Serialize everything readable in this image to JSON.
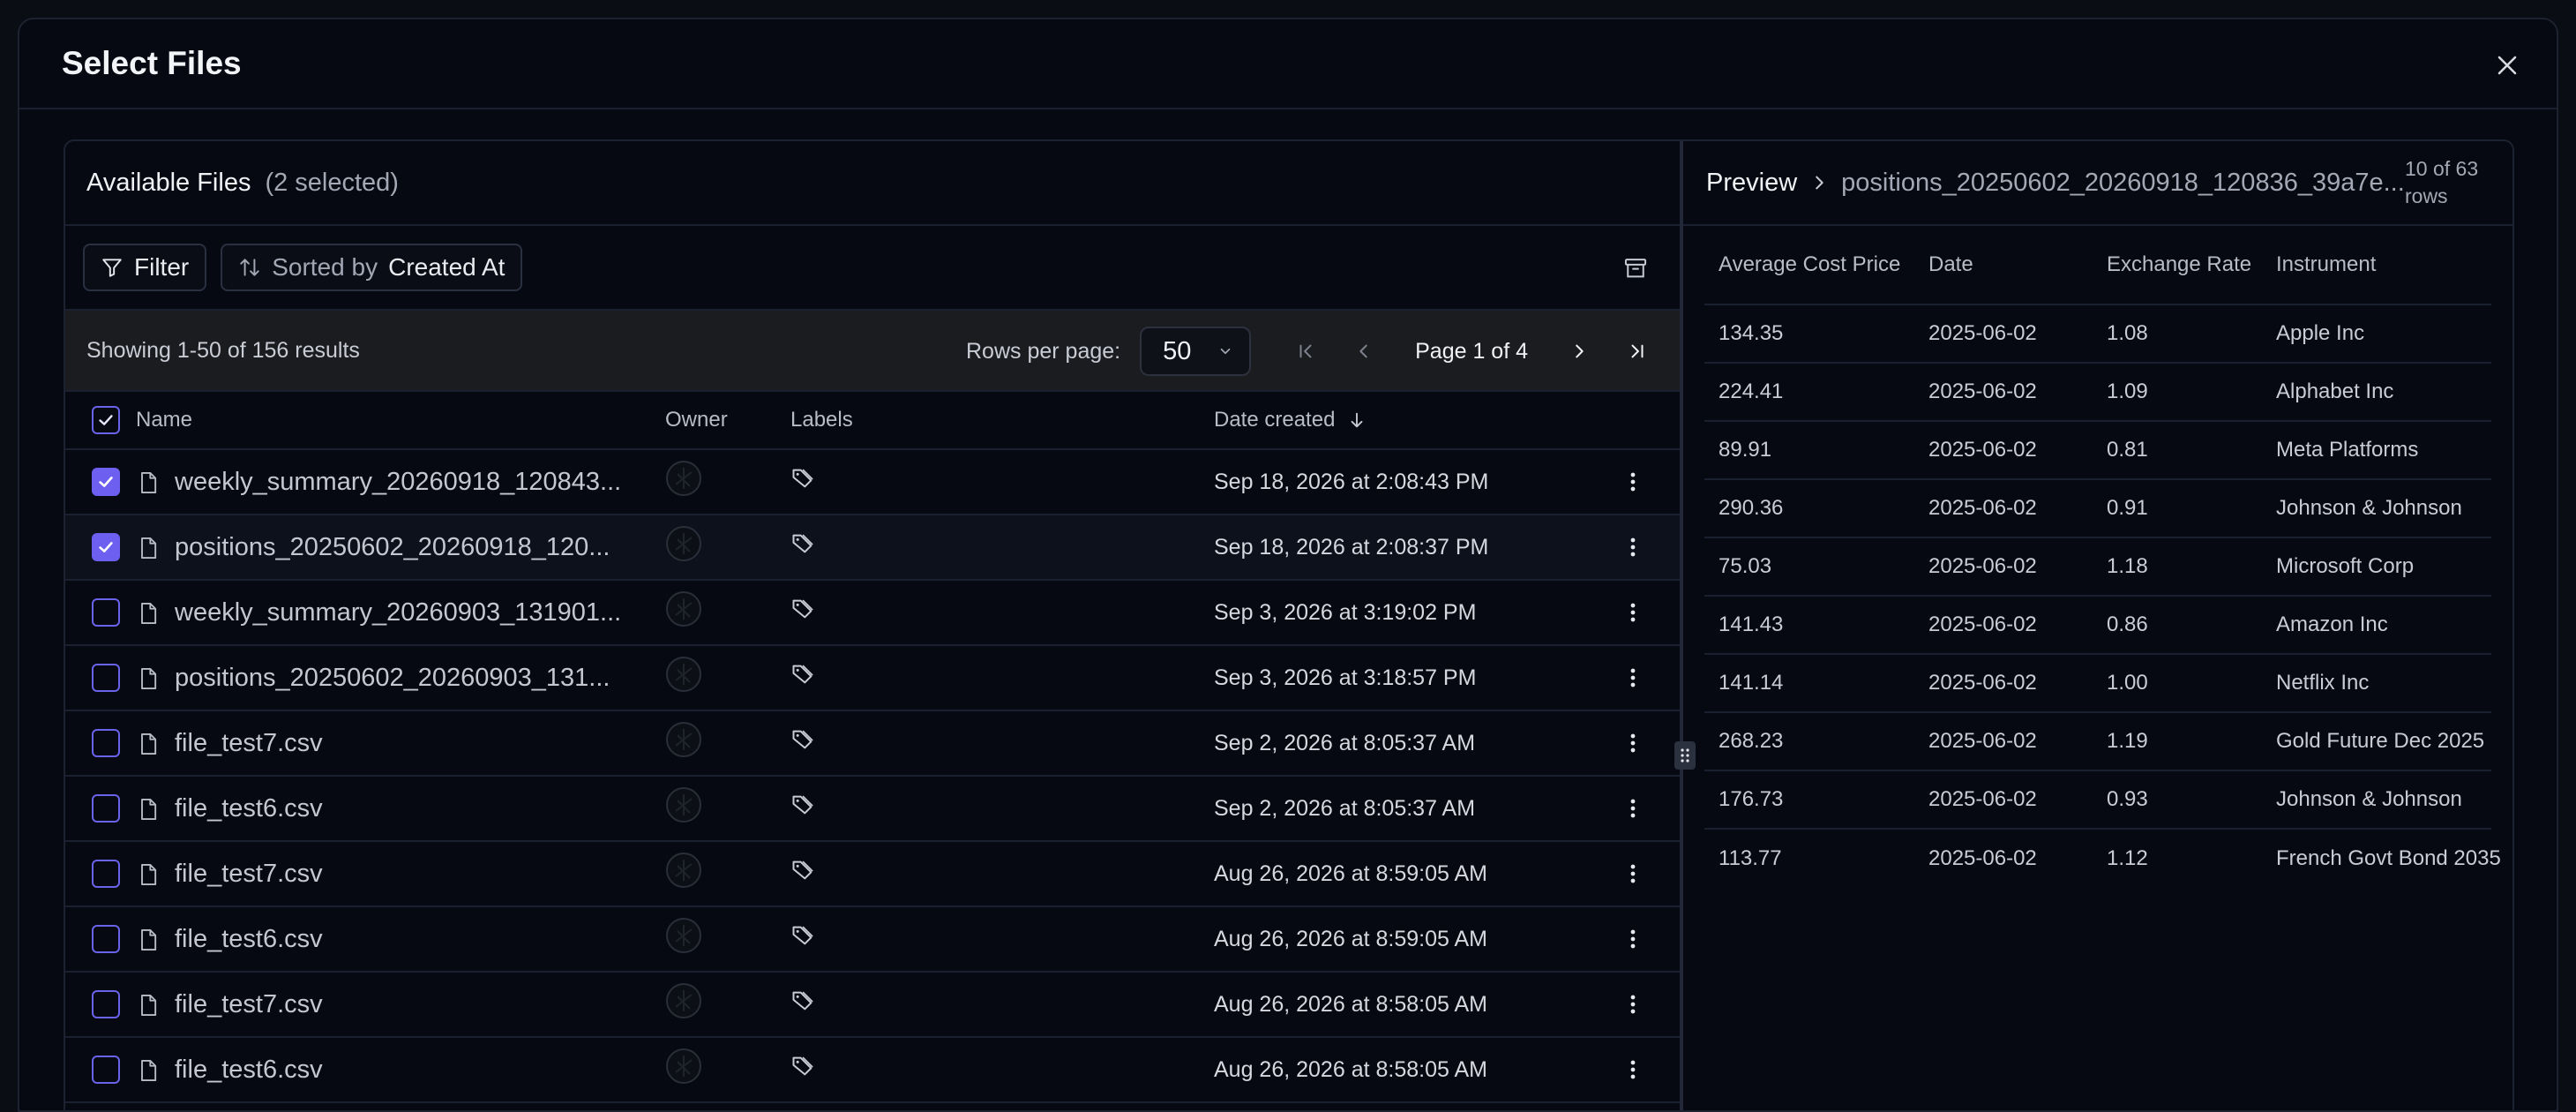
{
  "dialog": {
    "title": "Select Files"
  },
  "files_panel": {
    "title": "Available Files",
    "selected_count": "(2 selected)",
    "filter_label": "Filter",
    "sorted_by_prefix": "Sorted by",
    "sorted_by_value": "Created At",
    "showing": "Showing 1-50 of 156 results",
    "rows_per_page_label": "Rows per page:",
    "rows_per_page_value": "50",
    "page_label": "Page 1 of 4",
    "columns": {
      "name": "Name",
      "owner": "Owner",
      "labels": "Labels",
      "date": "Date created"
    },
    "rows": [
      {
        "name": "weekly_summary_20260918_120843...",
        "date": "Sep 18, 2026 at 2:08:43 PM",
        "checked": true
      },
      {
        "name": "positions_20250602_20260918_120...",
        "date": "Sep 18, 2026 at 2:08:37 PM",
        "checked": true
      },
      {
        "name": "weekly_summary_20260903_131901...",
        "date": "Sep 3, 2026 at 3:19:02 PM",
        "checked": false
      },
      {
        "name": "positions_20250602_20260903_131...",
        "date": "Sep 3, 2026 at 3:18:57 PM",
        "checked": false
      },
      {
        "name": "file_test7.csv",
        "date": "Sep 2, 2026 at 8:05:37 AM",
        "checked": false
      },
      {
        "name": "file_test6.csv",
        "date": "Sep 2, 2026 at 8:05:37 AM",
        "checked": false
      },
      {
        "name": "file_test7.csv",
        "date": "Aug 26, 2026 at 8:59:05 AM",
        "checked": false
      },
      {
        "name": "file_test6.csv",
        "date": "Aug 26, 2026 at 8:59:05 AM",
        "checked": false
      },
      {
        "name": "file_test7.csv",
        "date": "Aug 26, 2026 at 8:58:05 AM",
        "checked": false
      },
      {
        "name": "file_test6.csv",
        "date": "Aug 26, 2026 at 8:58:05 AM",
        "checked": false
      }
    ]
  },
  "preview": {
    "title": "Preview",
    "file": "positions_20250602_20260918_120836_39a7e...",
    "row_count": "10 of 63 rows",
    "columns": [
      "Average Cost Price",
      "Date",
      "Exchange Rate",
      "Instrument"
    ],
    "rows": [
      [
        "134.35",
        "2025-06-02",
        "1.08",
        "Apple Inc"
      ],
      [
        "224.41",
        "2025-06-02",
        "1.09",
        "Alphabet Inc"
      ],
      [
        "89.91",
        "2025-06-02",
        "0.81",
        "Meta Platforms"
      ],
      [
        "290.36",
        "2025-06-02",
        "0.91",
        "Johnson & Johnson"
      ],
      [
        "75.03",
        "2025-06-02",
        "1.18",
        "Microsoft Corp"
      ],
      [
        "141.43",
        "2025-06-02",
        "0.86",
        "Amazon Inc"
      ],
      [
        "141.14",
        "2025-06-02",
        "1.00",
        "Netflix Inc"
      ],
      [
        "268.23",
        "2025-06-02",
        "1.19",
        "Gold Future Dec 2025"
      ],
      [
        "176.73",
        "2025-06-02",
        "0.93",
        "Johnson & Johnson"
      ],
      [
        "113.77",
        "2025-06-02",
        "1.12",
        "French Govt Bond 2035"
      ]
    ]
  },
  "colors": {
    "accent": "#6d5ff0",
    "background": "#060912",
    "border": "#1d2230"
  }
}
